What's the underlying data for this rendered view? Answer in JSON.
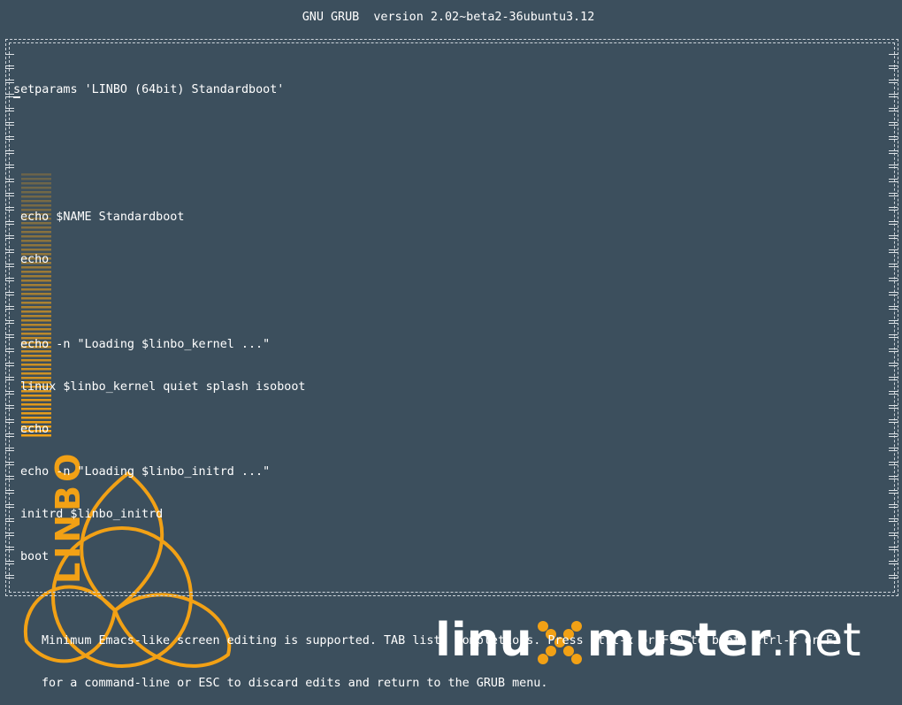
{
  "header": {
    "title": "GNU GRUB  version 2.02~beta2-36ubuntu3.12"
  },
  "editor": {
    "lines": [
      "setparams 'LINBO (64bit) Standardboot'",
      "",
      "",
      "echo $NAME Standardboot",
      "echo",
      "",
      "echo -n \"Loading $linbo_kernel ...\"",
      "linux $linbo_kernel quiet splash isoboot",
      "echo",
      "echo -n \"Loading $linbo_initrd ...\"",
      "initrd $linbo_initrd",
      "boot"
    ]
  },
  "help": {
    "line1": "Minimum Emacs-like screen editing is supported. TAB lists completions. Press Ctrl-x or F10 to boot, Ctrl-c or F2",
    "line2": "for a command-line or ESC to discard edits and return to the GRUB menu."
  },
  "branding": {
    "linbo_text": "LINBO",
    "logo_part1": "linu",
    "logo_part2": "muster",
    "logo_part3": ".net",
    "accent_color": "#f2a115",
    "background_color": "#3c4f5d"
  }
}
